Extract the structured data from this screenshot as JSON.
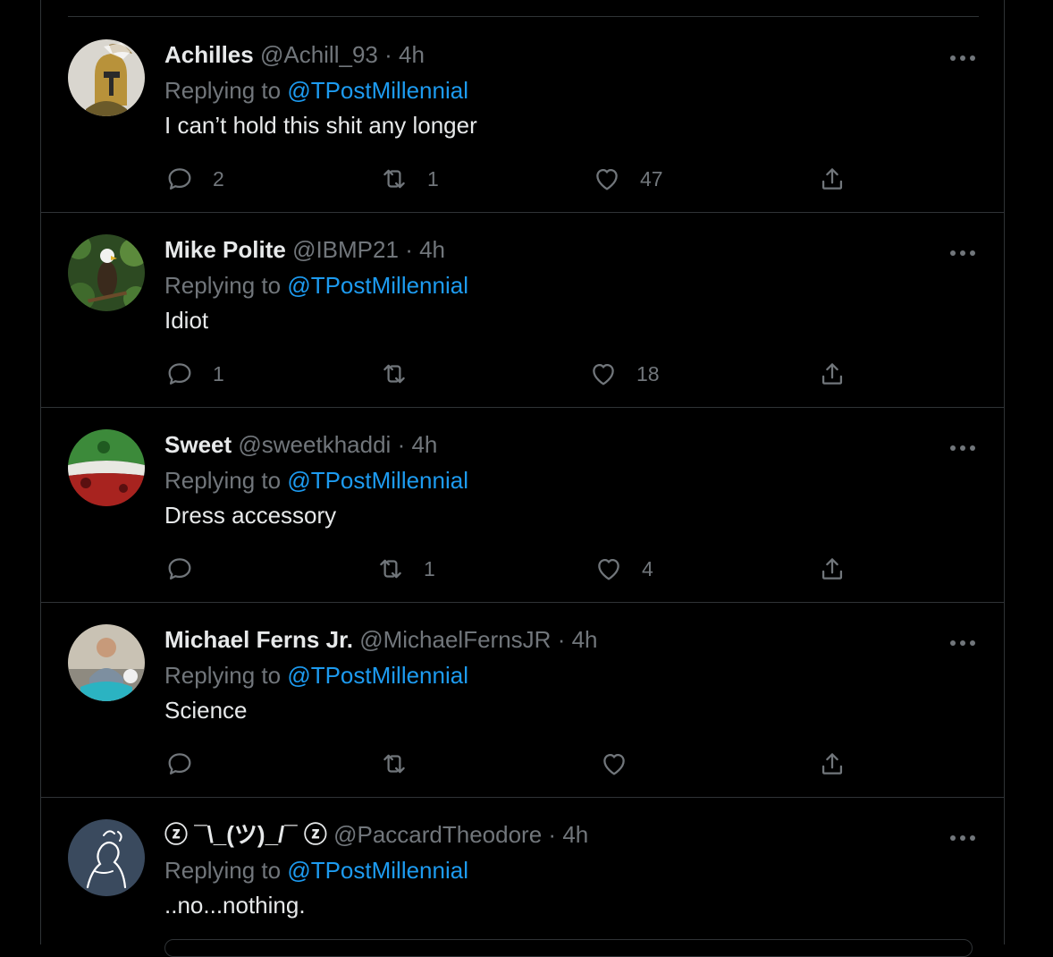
{
  "colors": {
    "background": "#000000",
    "divider": "#2f3336",
    "text_primary": "#e7e9ea",
    "text_secondary": "#71767b",
    "mention": "#1d9bf0"
  },
  "labels": {
    "replying_to": "Replying to",
    "separator": "·"
  },
  "tweets": [
    {
      "name": "Achilles",
      "handle": "@Achill_93",
      "time": "4h",
      "replying_to": "@TPostMillennial",
      "text": "I can’t hold this shit any longer",
      "replies": "2",
      "retweets": "1",
      "likes": "47",
      "avatar": "spartan-helmet-avatar"
    },
    {
      "name": "Mike Polite",
      "handle": "@IBMP21",
      "time": "4h",
      "replying_to": "@TPostMillennial",
      "text": "Idiot",
      "replies": "1",
      "retweets": "",
      "likes": "18",
      "avatar": "bald-eagle-avatar"
    },
    {
      "name": "Sweet",
      "handle": "@sweetkhaddi",
      "time": "4h",
      "replying_to": "@TPostMillennial",
      "text": "Dress accessory",
      "replies": "",
      "retweets": "1",
      "likes": "4",
      "avatar": "flag-avatar"
    },
    {
      "name": "Michael Ferns Jr.",
      "handle": "@MichaelFernsJR",
      "time": "4h",
      "replying_to": "@TPostMillennial",
      "text": "Science",
      "replies": "",
      "retweets": "",
      "likes": "",
      "avatar": "person-photo-avatar"
    },
    {
      "name": "ⓩ ¯\\_(ツ)_/¯ ⓩ",
      "handle": "@PaccardTheodore",
      "time": "4h",
      "replying_to": "@TPostMillennial",
      "text": "..no...nothing.",
      "replies": "",
      "retweets": "",
      "likes": "",
      "avatar": "sketch-avatar"
    }
  ]
}
